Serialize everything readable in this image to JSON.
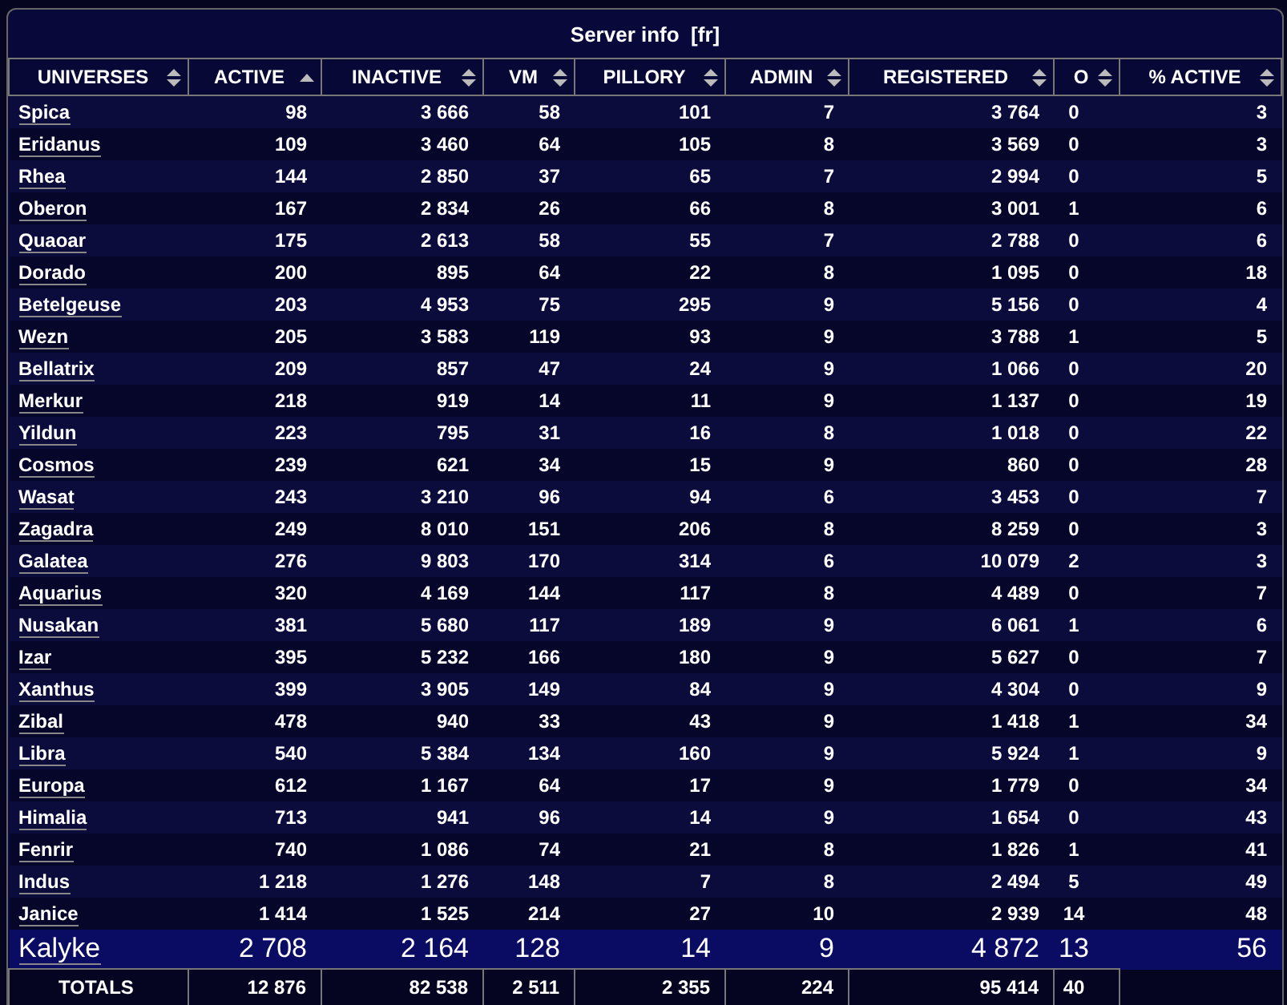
{
  "title": "Server info  [fr]",
  "columns": [
    {
      "label": "UNIVERSES",
      "sorted": false
    },
    {
      "label": "ACTIVE",
      "sorted": true
    },
    {
      "label": "INACTIVE",
      "sorted": false
    },
    {
      "label": "VM",
      "sorted": false
    },
    {
      "label": "PILLORY",
      "sorted": false
    },
    {
      "label": "ADMIN",
      "sorted": false
    },
    {
      "label": "REGISTERED",
      "sorted": false
    },
    {
      "label": "O",
      "sorted": false
    },
    {
      "label": "% ACTIVE",
      "sorted": false
    }
  ],
  "rows": [
    {
      "universe": "Spica",
      "values": [
        "98",
        "3 666",
        "58",
        "101",
        "7",
        "3 764",
        "0",
        "3"
      ],
      "highlighted": false
    },
    {
      "universe": "Eridanus",
      "values": [
        "109",
        "3 460",
        "64",
        "105",
        "8",
        "3 569",
        "0",
        "3"
      ],
      "highlighted": false
    },
    {
      "universe": "Rhea",
      "values": [
        "144",
        "2 850",
        "37",
        "65",
        "7",
        "2 994",
        "0",
        "5"
      ],
      "highlighted": false
    },
    {
      "universe": "Oberon",
      "values": [
        "167",
        "2 834",
        "26",
        "66",
        "8",
        "3 001",
        "1",
        "6"
      ],
      "highlighted": false
    },
    {
      "universe": "Quaoar",
      "values": [
        "175",
        "2 613",
        "58",
        "55",
        "7",
        "2 788",
        "0",
        "6"
      ],
      "highlighted": false
    },
    {
      "universe": "Dorado",
      "values": [
        "200",
        "895",
        "64",
        "22",
        "8",
        "1 095",
        "0",
        "18"
      ],
      "highlighted": false
    },
    {
      "universe": "Betelgeuse",
      "values": [
        "203",
        "4 953",
        "75",
        "295",
        "9",
        "5 156",
        "0",
        "4"
      ],
      "highlighted": false
    },
    {
      "universe": "Wezn",
      "values": [
        "205",
        "3 583",
        "119",
        "93",
        "9",
        "3 788",
        "1",
        "5"
      ],
      "highlighted": false
    },
    {
      "universe": "Bellatrix",
      "values": [
        "209",
        "857",
        "47",
        "24",
        "9",
        "1 066",
        "0",
        "20"
      ],
      "highlighted": false
    },
    {
      "universe": "Merkur",
      "values": [
        "218",
        "919",
        "14",
        "11",
        "9",
        "1 137",
        "0",
        "19"
      ],
      "highlighted": false
    },
    {
      "universe": "Yildun",
      "values": [
        "223",
        "795",
        "31",
        "16",
        "8",
        "1 018",
        "0",
        "22"
      ],
      "highlighted": false
    },
    {
      "universe": "Cosmos",
      "values": [
        "239",
        "621",
        "34",
        "15",
        "9",
        "860",
        "0",
        "28"
      ],
      "highlighted": false
    },
    {
      "universe": "Wasat",
      "values": [
        "243",
        "3 210",
        "96",
        "94",
        "6",
        "3 453",
        "0",
        "7"
      ],
      "highlighted": false
    },
    {
      "universe": "Zagadra",
      "values": [
        "249",
        "8 010",
        "151",
        "206",
        "8",
        "8 259",
        "0",
        "3"
      ],
      "highlighted": false
    },
    {
      "universe": "Galatea",
      "values": [
        "276",
        "9 803",
        "170",
        "314",
        "6",
        "10 079",
        "2",
        "3"
      ],
      "highlighted": false
    },
    {
      "universe": "Aquarius",
      "values": [
        "320",
        "4 169",
        "144",
        "117",
        "8",
        "4 489",
        "0",
        "7"
      ],
      "highlighted": false
    },
    {
      "universe": "Nusakan",
      "values": [
        "381",
        "5 680",
        "117",
        "189",
        "9",
        "6 061",
        "1",
        "6"
      ],
      "highlighted": false
    },
    {
      "universe": "Izar",
      "values": [
        "395",
        "5 232",
        "166",
        "180",
        "9",
        "5 627",
        "0",
        "7"
      ],
      "highlighted": false
    },
    {
      "universe": "Xanthus",
      "values": [
        "399",
        "3 905",
        "149",
        "84",
        "9",
        "4 304",
        "0",
        "9"
      ],
      "highlighted": false
    },
    {
      "universe": "Zibal",
      "values": [
        "478",
        "940",
        "33",
        "43",
        "9",
        "1 418",
        "1",
        "34"
      ],
      "highlighted": false
    },
    {
      "universe": "Libra",
      "values": [
        "540",
        "5 384",
        "134",
        "160",
        "9",
        "5 924",
        "1",
        "9"
      ],
      "highlighted": false
    },
    {
      "universe": "Europa",
      "values": [
        "612",
        "1 167",
        "64",
        "17",
        "9",
        "1 779",
        "0",
        "34"
      ],
      "highlighted": false
    },
    {
      "universe": "Himalia",
      "values": [
        "713",
        "941",
        "96",
        "14",
        "9",
        "1 654",
        "0",
        "43"
      ],
      "highlighted": false
    },
    {
      "universe": "Fenrir",
      "values": [
        "740",
        "1 086",
        "74",
        "21",
        "8",
        "1 826",
        "1",
        "41"
      ],
      "highlighted": false
    },
    {
      "universe": "Indus",
      "values": [
        "1 218",
        "1 276",
        "148",
        "7",
        "8",
        "2 494",
        "5",
        "49"
      ],
      "highlighted": false
    },
    {
      "universe": "Janice",
      "values": [
        "1 414",
        "1 525",
        "214",
        "27",
        "10",
        "2 939",
        "14",
        "48"
      ],
      "highlighted": false
    },
    {
      "universe": "Kalyke",
      "values": [
        "2 708",
        "2 164",
        "128",
        "14",
        "9",
        "4 872",
        "13",
        "56"
      ],
      "highlighted": true
    }
  ],
  "totals": {
    "label": "TOTALS",
    "values": [
      "12 876",
      "82 538",
      "2 511",
      "2 355",
      "224",
      "95 414",
      "40"
    ]
  }
}
